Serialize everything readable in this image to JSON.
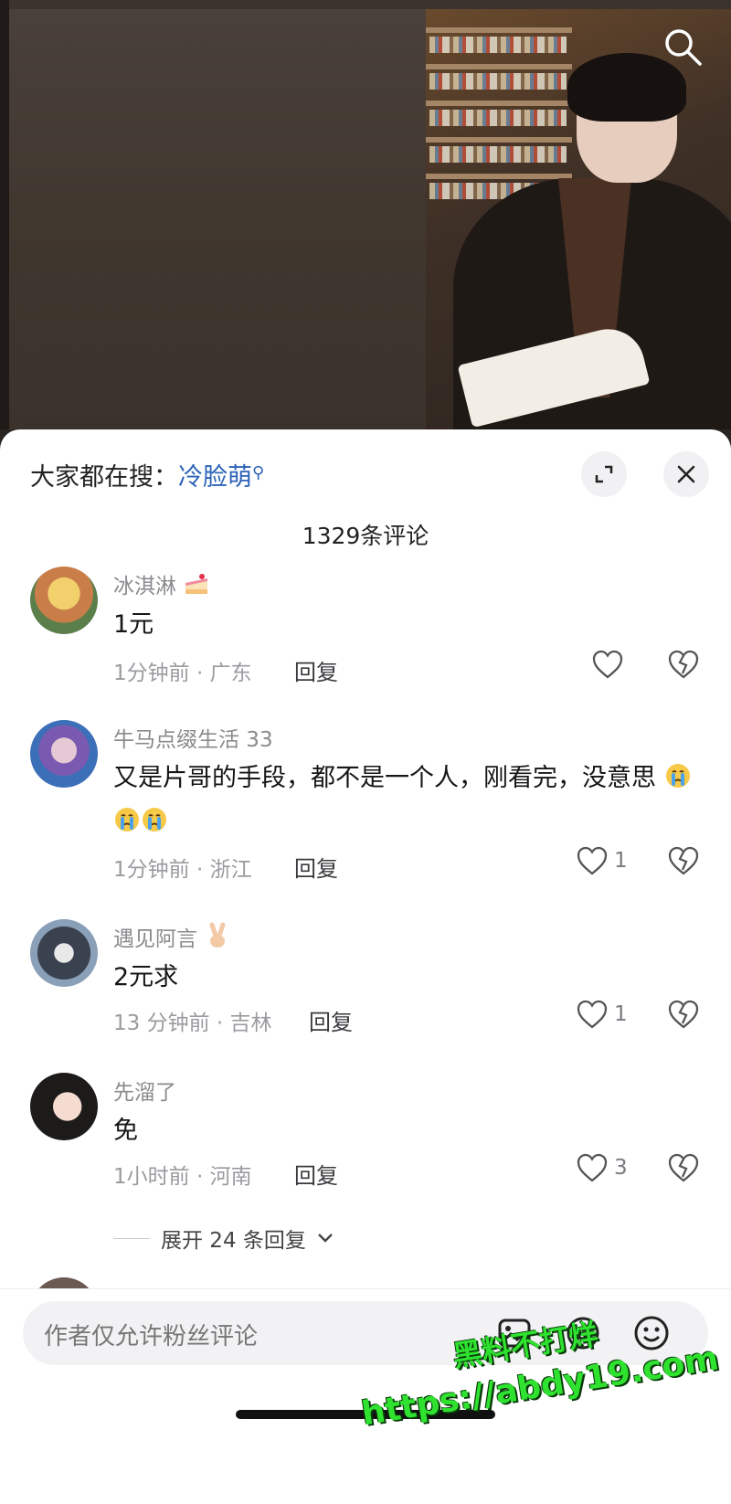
{
  "header": {
    "hot_search_prefix": "大家都在搜：",
    "hot_search_keyword": "冷脸萌",
    "comment_count": "1329条评论"
  },
  "comments": [
    {
      "name": "冰淇淋",
      "name_emoji": "cake",
      "text": "1元",
      "meta": "1分钟前 · 广东",
      "reply": "回复",
      "likes": ""
    },
    {
      "name": "牛马点缀生活 33",
      "text": "又是片哥的手段，都不是一个人，刚看完，没意思",
      "text_emojis": [
        "crying-face",
        "crying-face",
        "crying-face"
      ],
      "meta": "1分钟前 · 浙江",
      "reply": "回复",
      "likes": "1"
    },
    {
      "name": "遇见阿言",
      "name_emoji": "victory-hand",
      "text": "2元求",
      "meta": "13 分钟前 · 吉林",
      "reply": "回复",
      "likes": "1"
    },
    {
      "name": "先溜了",
      "text": "免",
      "meta": "1小时前 · 河南",
      "reply": "回复",
      "likes": "3",
      "expand_replies": "展开 24 条回复"
    }
  ],
  "input": {
    "placeholder": "作者仅允许粉丝评论"
  },
  "watermark": {
    "line1": "黑料不打烊",
    "line2": "https://abdy19.com"
  },
  "colors": {
    "keyword": "#2b63b8",
    "watermark": "#2fe22f"
  }
}
